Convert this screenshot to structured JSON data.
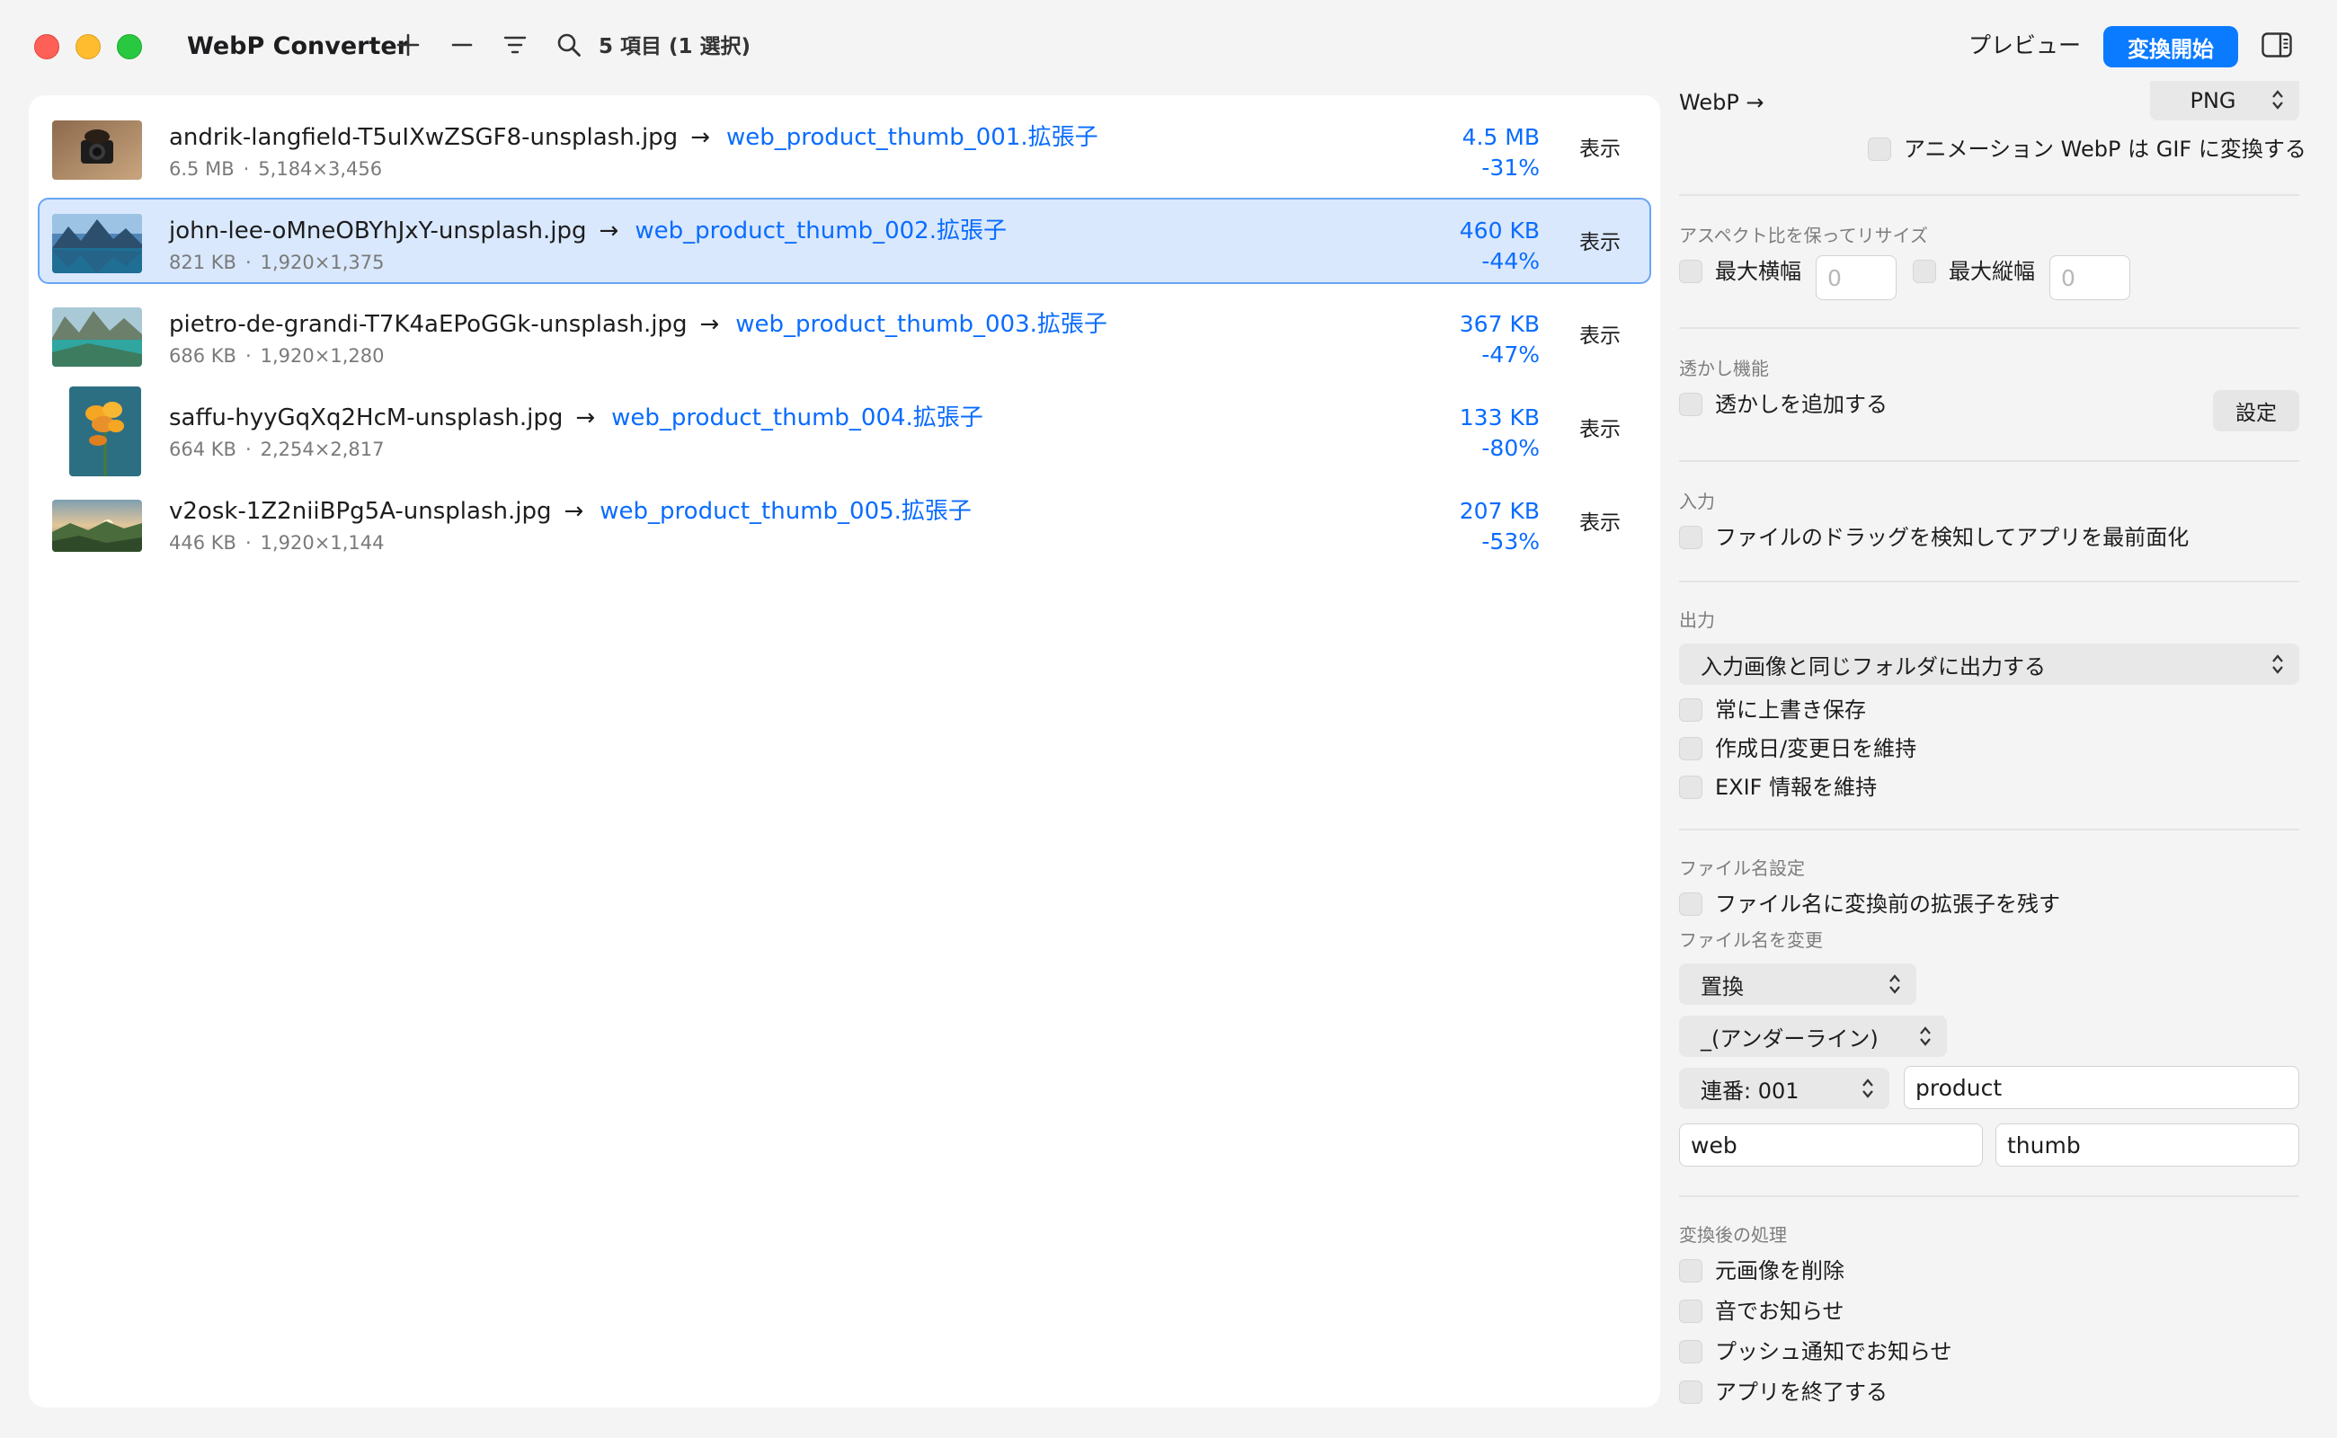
{
  "app": {
    "title": "WebP Converter",
    "item_count": "5 項目 (1 選択)"
  },
  "toolbar": {
    "preview_label": "プレビュー",
    "start_label": "変換開始"
  },
  "files": [
    {
      "source": "andrik-langfield-T5uIXwZSGF8-unsplash.jpg",
      "output": "web_product_thumb_001.拡張子",
      "src_size": "6.5 MB",
      "dimensions": "5,184×3,456",
      "out_size": "4.5 MB",
      "ratio": "-31%",
      "action": "表示",
      "selected": false
    },
    {
      "source": "john-lee-oMneOBYhJxY-unsplash.jpg",
      "output": "web_product_thumb_002.拡張子",
      "src_size": "821 KB",
      "dimensions": "1,920×1,375",
      "out_size": "460 KB",
      "ratio": "-44%",
      "action": "表示",
      "selected": true
    },
    {
      "source": "pietro-de-grandi-T7K4aEPoGGk-unsplash.jpg",
      "output": "web_product_thumb_003.拡張子",
      "src_size": "686 KB",
      "dimensions": "1,920×1,280",
      "out_size": "367 KB",
      "ratio": "-47%",
      "action": "表示",
      "selected": false
    },
    {
      "source": "saffu-hyyGqXq2HcM-unsplash.jpg",
      "output": "web_product_thumb_004.拡張子",
      "src_size": "664 KB",
      "dimensions": "2,254×2,817",
      "out_size": "133 KB",
      "ratio": "-80%",
      "action": "表示",
      "selected": false
    },
    {
      "source": "v2osk-1Z2niiBPg5A-unsplash.jpg",
      "output": "web_product_thumb_005.拡張子",
      "src_size": "446 KB",
      "dimensions": "1,920×1,144",
      "out_size": "207 KB",
      "ratio": "-53%",
      "action": "表示",
      "selected": false
    }
  ],
  "settings": {
    "webp_label": "WebP →",
    "webp_format": "PNG",
    "anim_gif": "アニメーション WebP は GIF に変換する",
    "resize": {
      "title": "アスペクト比を保ってリサイズ",
      "max_width": "最大横幅",
      "max_width_ph": "0",
      "max_height": "最大縦幅",
      "max_height_ph": "0"
    },
    "watermark": {
      "title": "透かし機能",
      "add": "透かしを追加する",
      "settings_btn": "設定"
    },
    "input": {
      "title": "入力",
      "drag_front": "ファイルのドラッグを検知してアプリを最前面化"
    },
    "output": {
      "title": "出力",
      "folder": "入力画像と同じフォルダに出力する",
      "overwrite": "常に上書き保存",
      "keep_dates": "作成日/変更日を維持",
      "keep_exif": "EXIF 情報を維持"
    },
    "filename": {
      "title": "ファイル名設定",
      "keep_ext": "ファイル名に変換前の拡張子を残す",
      "rename_title": "ファイル名を変更",
      "mode": "置換",
      "separator": "_(アンダーライン)",
      "sequence": "連番: 001",
      "field_a": "product",
      "field_b": "web",
      "field_c": "thumb"
    },
    "post": {
      "title": "変換後の処理",
      "delete_src": "元画像を削除",
      "sound": "音でお知らせ",
      "push": "プッシュ通知でお知らせ",
      "quit": "アプリを終了する"
    }
  }
}
